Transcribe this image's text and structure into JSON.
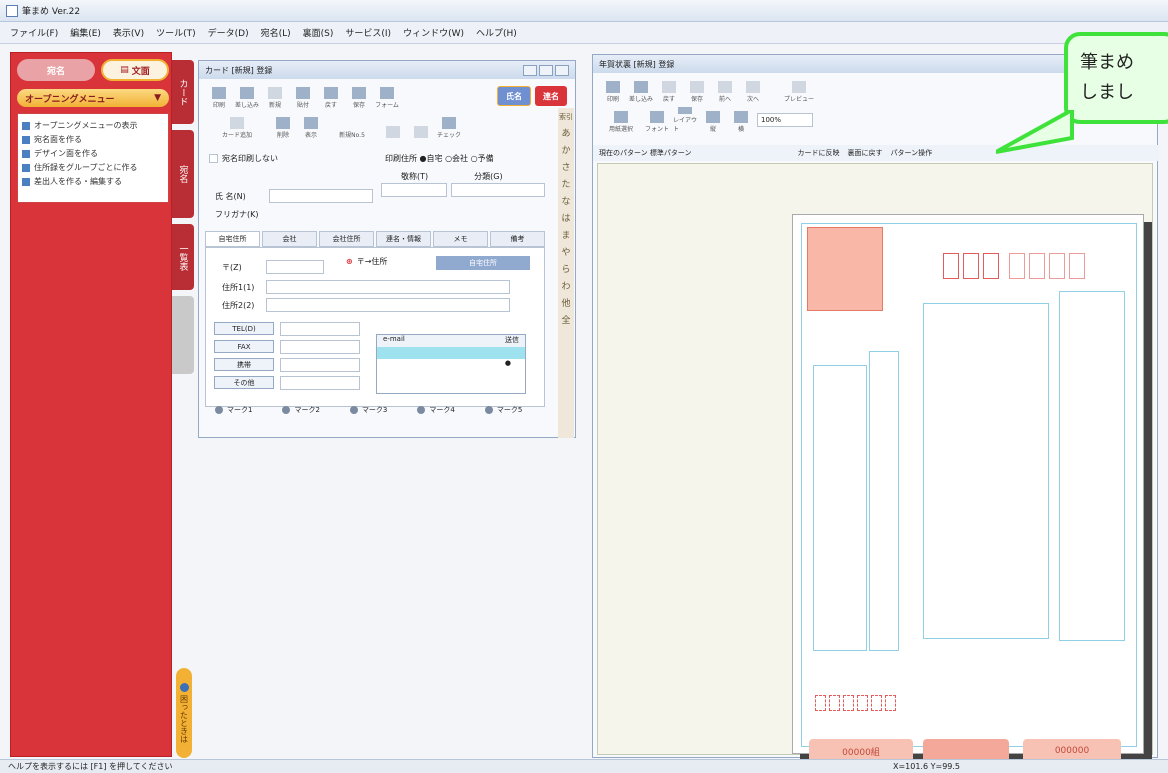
{
  "app": {
    "title": "筆まめ Ver.22"
  },
  "menu": [
    "ファイル(F)",
    "編集(E)",
    "表示(V)",
    "ツール(T)",
    "データ(D)",
    "宛名(L)",
    "裏面(S)",
    "サービス(I)",
    "ウィンドウ(W)",
    "ヘルプ(H)"
  ],
  "sidebar": {
    "btn_a": "宛名",
    "btn_b": "文面",
    "opening": "オープニングメニュー",
    "items": [
      "オープニングメニューの表示",
      "宛名面を作る",
      "デザイン面を作る",
      "住所録をグループごとに作る",
      "差出人を作る・編集する"
    ],
    "vtabs": [
      "カード",
      "宛名",
      "一覧表"
    ],
    "help": "困ったときは"
  },
  "card": {
    "title": "カード [新規] 登録",
    "toolbar": [
      "印刷",
      "差し込み",
      "新規",
      "貼付",
      "戻す",
      "保存",
      "フォーム"
    ],
    "pill_blue": "氏名",
    "pill_red": "連名",
    "toolbar2": [
      "カード追加",
      "削除",
      "表示",
      "新規No.5",
      "チェック"
    ],
    "no_print": "宛名印刷しない",
    "print_addr": "印刷住所 ●自宅 ○会社 ○予備",
    "title_label": "敬称(T)",
    "category_label": "分類(G)",
    "name_label": "氏 名(N)",
    "kana_label": "フリガナ(K)",
    "tabs": [
      "自宅住所",
      "会社",
      "会社住所",
      "連名・情報",
      "メモ",
      "備考"
    ],
    "zip_label": "〒(Z)",
    "zip_search": "〒→住所",
    "home_addr": "自宅住所",
    "addr1_label": "住所1(1)",
    "addr2_label": "住所2(2)",
    "tel_labels": [
      "TEL(D)",
      "FAX",
      "携帯",
      "その他"
    ],
    "email_header": "e-mail",
    "send_header": "送信",
    "send_value": "●",
    "radios": [
      "マーク1",
      "マーク2",
      "マーク3",
      "マーク4",
      "マーク5"
    ],
    "kana_index": [
      "索引",
      "あ",
      "か",
      "さ",
      "た",
      "な",
      "は",
      "ま",
      "や",
      "ら",
      "わ",
      "他",
      "全"
    ]
  },
  "nenga": {
    "title": "年賀状裏 [新規] 登録",
    "toolbar": [
      "印刷",
      "差し込み",
      "戻す",
      "保存",
      "前へ",
      "次へ",
      "プレビュー"
    ],
    "toolbar2": [
      "用紙選択",
      "フォント",
      "レイアウト",
      "縦",
      "横",
      "100%"
    ],
    "pattern_label": "現在のパターン 標準パターン",
    "pattern_actions": [
      "カードに反映",
      "裏面に戻す",
      "パターン操作"
    ],
    "lottery": [
      "00000組",
      "000000"
    ]
  },
  "callout": {
    "text": "筆まめ\nしまし"
  },
  "status": {
    "left": "ヘルプを表示するには [F1] を押してください",
    "right": "X=101.6 Y=99.5"
  },
  "colors": {
    "sidebar_red": "#d8343a",
    "callout_green": "#3ee23a",
    "accent_gold": "#f2b135"
  }
}
